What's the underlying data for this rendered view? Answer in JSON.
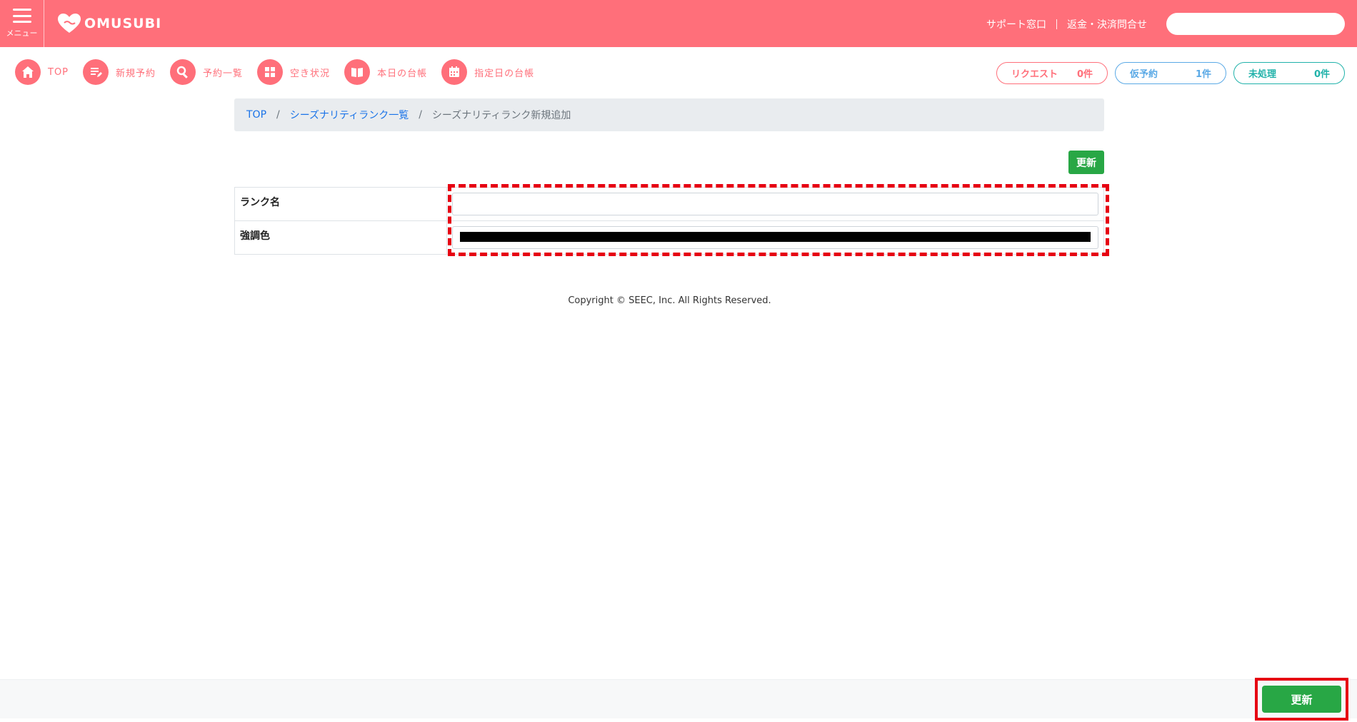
{
  "header": {
    "menu_label": "メニュー",
    "logo_text": "OMUSUBI",
    "links": [
      "サポート窓口",
      "返金・決済問合せ"
    ],
    "search_placeholder": ""
  },
  "nav": {
    "items": [
      {
        "label": "TOP",
        "icon": "home-icon"
      },
      {
        "label": "新規予約",
        "icon": "edit-list-icon"
      },
      {
        "label": "予約一覧",
        "icon": "search-icon"
      },
      {
        "label": "空き状況",
        "icon": "grid-icon"
      },
      {
        "label": "本日の台帳",
        "icon": "book-icon"
      },
      {
        "label": "指定日の台帳",
        "icon": "calendar-icon"
      }
    ],
    "status": [
      {
        "label": "リクエスト",
        "count": "0件",
        "color": "#ff6f7a"
      },
      {
        "label": "仮予約",
        "count": "1件",
        "color": "#5aa9e6"
      },
      {
        "label": "未処理",
        "count": "0件",
        "color": "#20b2aa"
      }
    ]
  },
  "breadcrumb": {
    "items": [
      "TOP",
      "シーズナリティランク一覧"
    ],
    "current": "シーズナリティランク新規追加"
  },
  "form": {
    "update_label": "更新",
    "fields": [
      {
        "label": "ランク名",
        "value": ""
      },
      {
        "label": "強調色",
        "value": "#000000"
      }
    ]
  },
  "copyright": "Copyright © SEEC, Inc. All Rights Reserved.",
  "footer": {
    "update_label": "更新"
  },
  "colors": {
    "brand": "#ff6f7a",
    "update_button": "#28a745",
    "highlight": "#e60012"
  }
}
